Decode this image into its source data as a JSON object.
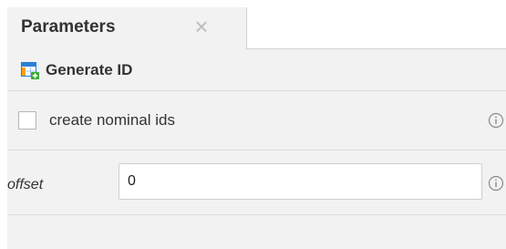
{
  "tab": {
    "label": "Parameters",
    "close_glyph": "×",
    "close_icon": "close-icon"
  },
  "operator": {
    "title": "Generate ID",
    "icon": "generate-id-icon"
  },
  "parameters": {
    "create_nominal_ids": {
      "label": "create nominal ids",
      "checked": false,
      "info_icon": "info-icon"
    },
    "offset": {
      "label": "offset",
      "value": "0",
      "info_icon": "info-icon"
    }
  },
  "colors": {
    "panel_background": "#f2f2f2",
    "icon_blue": "#2a7fd4",
    "icon_orange": "#f7a21b",
    "icon_green": "#3aaa35"
  }
}
